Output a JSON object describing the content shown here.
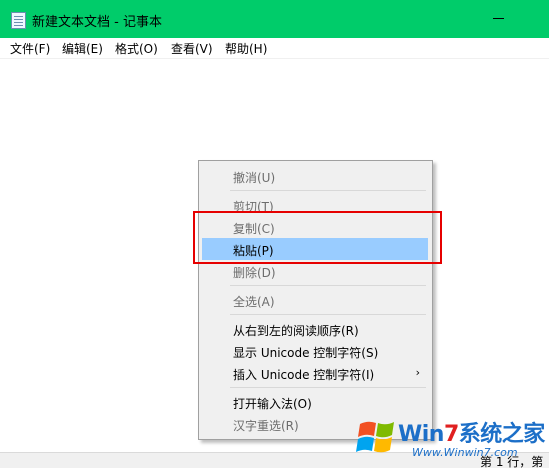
{
  "window": {
    "title": "新建文本文档 - 记事本"
  },
  "menubar": {
    "items": [
      {
        "label": "文件(F)"
      },
      {
        "label": "编辑(E)"
      },
      {
        "label": "格式(O)"
      },
      {
        "label": "查看(V)"
      },
      {
        "label": "帮助(H)"
      }
    ]
  },
  "context_menu": {
    "items": [
      {
        "label": "撤消(U)",
        "enabled": false
      },
      {
        "label": "剪切(T)",
        "enabled": false
      },
      {
        "label": "复制(C)",
        "enabled": false
      },
      {
        "label": "粘贴(P)",
        "enabled": true,
        "highlighted": true
      },
      {
        "label": "删除(D)",
        "enabled": false
      },
      {
        "label": "全选(A)",
        "enabled": false
      },
      {
        "label": "从右到左的阅读顺序(R)",
        "enabled": true
      },
      {
        "label": "显示 Unicode 控制字符(S)",
        "enabled": true
      },
      {
        "label": "插入 Unicode 控制字符(I)",
        "enabled": true,
        "submenu_arrow": "›"
      },
      {
        "label": "打开输入法(O)",
        "enabled": true
      },
      {
        "label": "汉字重选(R)",
        "enabled": false
      }
    ]
  },
  "statusbar": {
    "text": "第 1 行，第"
  },
  "watermark": {
    "brand_prefix": "Win",
    "brand_seven": "7",
    "brand_suffix": "系统之家",
    "url": "Www.Winwin7.com"
  },
  "colors": {
    "titlebar": "#00cc6a",
    "highlight": "#99ccff",
    "annotation_box": "#e60000",
    "disabled_text": "#6d6d6d"
  }
}
